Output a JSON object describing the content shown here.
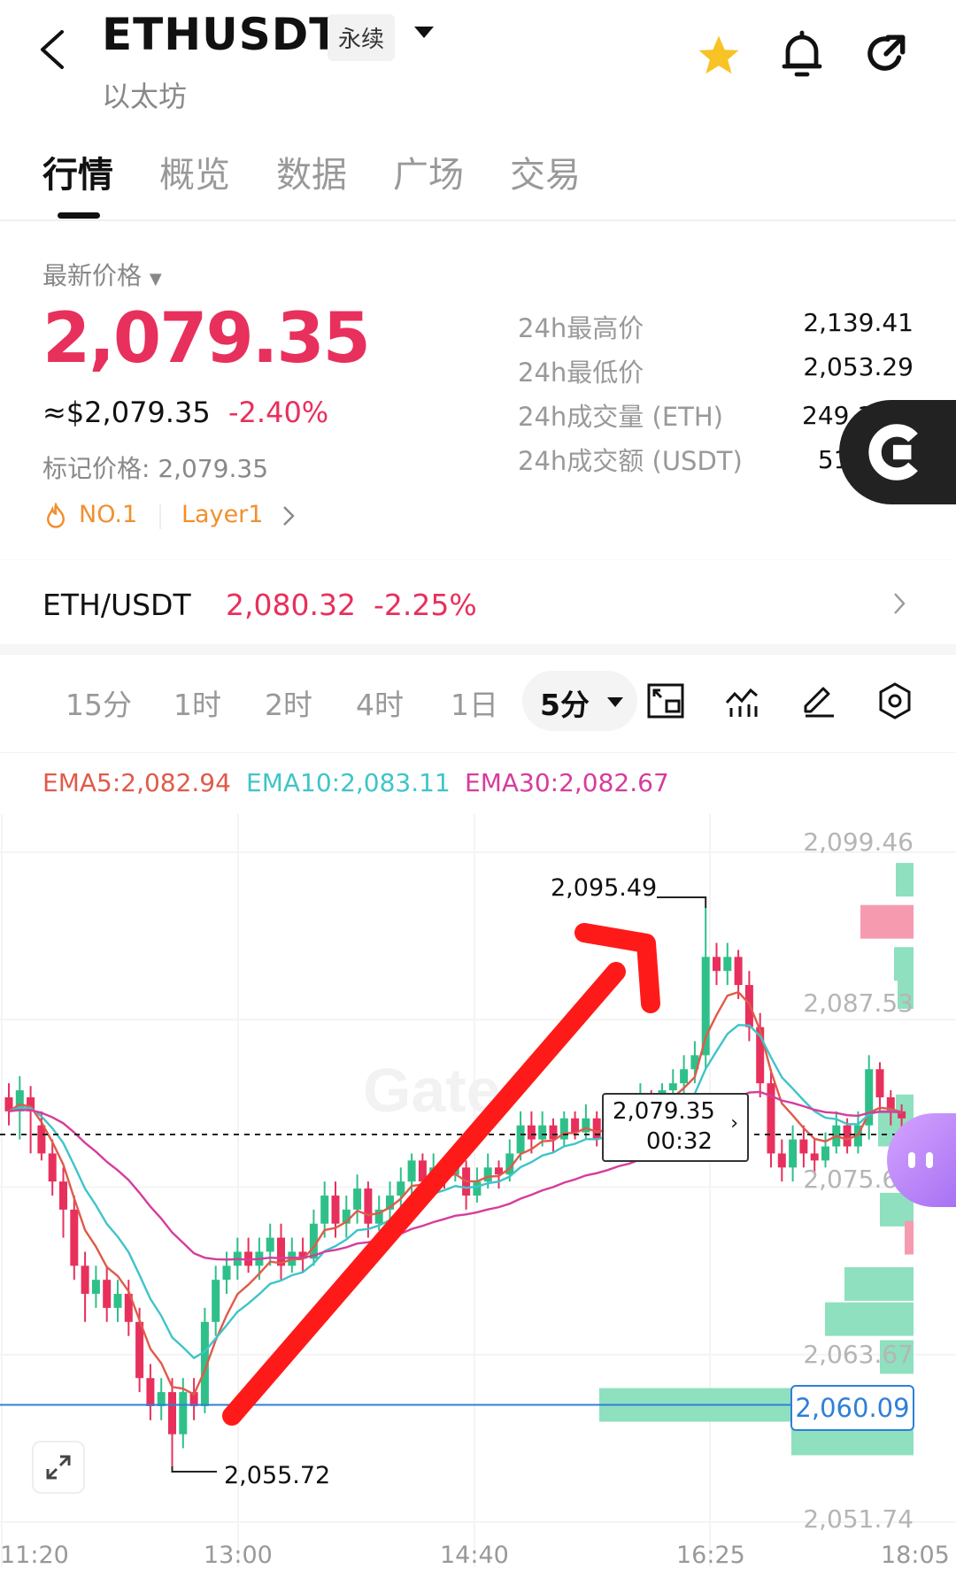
{
  "header": {
    "title": "ETHUSDT",
    "badge": "永续",
    "subtitle": "以太坊"
  },
  "tabs": [
    "行情",
    "概览",
    "数据",
    "广场",
    "交易"
  ],
  "price": {
    "label": "最新价格",
    "last": "2,079.35",
    "usd": "≈$2,079.35",
    "change": "-2.40%",
    "mark": "标记价格: 2,079.35"
  },
  "tags": {
    "rank": "NO.1",
    "sector": "Layer1"
  },
  "stats": [
    {
      "label": "24h最高价",
      "value": "2,139.41"
    },
    {
      "label": "24h最低价",
      "value": "2,053.29"
    },
    {
      "label": "24h成交量 (ETH)",
      "value": "249.14万"
    },
    {
      "label": "24h成交额 (USDT)",
      "value": "51.80亿"
    }
  ],
  "spot": {
    "name": "ETH/USDT",
    "price": "2,080.32",
    "change": "-2.25%"
  },
  "intervals": [
    "15分",
    "1时",
    "2时",
    "4时",
    "1日"
  ],
  "active_interval": "5分",
  "ema": {
    "ema5": "EMA5:2,082.94",
    "ema10": "EMA10:2,083.11",
    "ema30": "EMA30:2,082.67"
  },
  "colors": {
    "up": "#2fc08a",
    "down": "#e8305c",
    "ema5": "#e05a4a",
    "ema10": "#3fc4c9",
    "ema30": "#d63c9c",
    "accent_blue": "#2f7fd8",
    "star": "#f7c325"
  },
  "chart_data": {
    "type": "candlestick",
    "y_ticks": [
      "2,099.46",
      "2,087.53",
      "2,075.60",
      "2,063.67",
      "2,051.74"
    ],
    "x_ticks": [
      "11:20",
      "13:00",
      "14:40",
      "16:25",
      "18:05"
    ],
    "ylim": [
      2051.74,
      2099.46
    ],
    "high_label": "2,095.49",
    "low_label": "2,055.72",
    "current": {
      "price": "2,079.35",
      "countdown": "00:32"
    },
    "marker_price": "2,060.09",
    "candles": [
      [
        2082,
        2081,
        2083,
        2080
      ],
      [
        2081,
        2082.5,
        2083.5,
        2079
      ],
      [
        2082,
        2081,
        2082.8,
        2078
      ],
      [
        2080,
        2078,
        2081,
        2077.5
      ],
      [
        2078,
        2076,
        2079,
        2075
      ],
      [
        2076,
        2074,
        2077,
        2072
      ],
      [
        2074,
        2070,
        2075,
        2069
      ],
      [
        2070,
        2068,
        2071,
        2066
      ],
      [
        2068,
        2069,
        2070,
        2067
      ],
      [
        2069,
        2067,
        2070,
        2066
      ],
      [
        2067,
        2068,
        2069,
        2066
      ],
      [
        2068,
        2066,
        2069,
        2065
      ],
      [
        2066,
        2062,
        2067,
        2061
      ],
      [
        2062,
        2060,
        2063,
        2059
      ],
      [
        2060,
        2061,
        2062,
        2059
      ],
      [
        2061,
        2058,
        2062,
        2055.72
      ],
      [
        2058,
        2061,
        2062,
        2057
      ],
      [
        2061,
        2060,
        2062,
        2059
      ],
      [
        2060,
        2066,
        2067,
        2059.5
      ],
      [
        2066,
        2069,
        2070,
        2065
      ],
      [
        2069,
        2070,
        2071,
        2068
      ],
      [
        2070,
        2071,
        2072,
        2069
      ],
      [
        2071,
        2070,
        2072,
        2069.5
      ],
      [
        2070,
        2071,
        2072,
        2069
      ],
      [
        2071,
        2072,
        2073,
        2070
      ],
      [
        2072,
        2070,
        2073,
        2069
      ],
      [
        2070,
        2071,
        2072,
        2069.5
      ],
      [
        2071,
        2070.5,
        2072,
        2069.5
      ],
      [
        2070.5,
        2073,
        2074,
        2070
      ],
      [
        2073,
        2075,
        2076,
        2072
      ],
      [
        2075,
        2073,
        2076,
        2072
      ],
      [
        2073,
        2074,
        2075,
        2072
      ],
      [
        2074,
        2075.5,
        2076.5,
        2073
      ],
      [
        2075.5,
        2073,
        2076,
        2072
      ],
      [
        2073,
        2074,
        2075,
        2072.5
      ],
      [
        2074,
        2075,
        2076,
        2073
      ],
      [
        2075,
        2076,
        2077,
        2074
      ],
      [
        2076,
        2077.5,
        2078,
        2075
      ],
      [
        2077.5,
        2076,
        2078,
        2075
      ],
      [
        2076,
        2077,
        2078,
        2075.5
      ],
      [
        2077,
        2076.5,
        2077.5,
        2075.5
      ],
      [
        2076.5,
        2077,
        2078,
        2076
      ],
      [
        2077,
        2075,
        2077.5,
        2074
      ],
      [
        2075,
        2076,
        2077,
        2074.5
      ],
      [
        2076,
        2077,
        2078,
        2075.5
      ],
      [
        2077,
        2076.5,
        2077.5,
        2075.5
      ],
      [
        2076.5,
        2078,
        2079,
        2076
      ],
      [
        2078,
        2080,
        2081,
        2077.5
      ],
      [
        2080,
        2079,
        2081,
        2078
      ],
      [
        2079,
        2080,
        2081,
        2078.5
      ],
      [
        2080,
        2079,
        2080.5,
        2078
      ],
      [
        2079,
        2080.5,
        2081,
        2078.5
      ],
      [
        2080.5,
        2079.5,
        2081,
        2079
      ],
      [
        2079.5,
        2080.5,
        2081.5,
        2079
      ],
      [
        2080.5,
        2079,
        2081,
        2078.5
      ],
      [
        2079,
        2080,
        2081,
        2078.5
      ],
      [
        2080,
        2081,
        2082,
        2079.5
      ],
      [
        2081,
        2080,
        2081.5,
        2079
      ],
      [
        2080,
        2082,
        2083,
        2079.5
      ],
      [
        2082,
        2081.5,
        2082.5,
        2081
      ],
      [
        2081.5,
        2082.5,
        2083,
        2081
      ],
      [
        2082.5,
        2083,
        2084,
        2082
      ],
      [
        2083,
        2084,
        2085,
        2082
      ],
      [
        2084,
        2085,
        2086,
        2083
      ],
      [
        2085,
        2092,
        2095.49,
        2084
      ],
      [
        2092,
        2091,
        2093,
        2090
      ],
      [
        2091,
        2092,
        2093,
        2090
      ],
      [
        2092,
        2090,
        2092.5,
        2089
      ],
      [
        2090,
        2087,
        2091,
        2086
      ],
      [
        2087,
        2083,
        2088,
        2082
      ],
      [
        2083,
        2078,
        2084,
        2077
      ],
      [
        2078,
        2077,
        2079,
        2076
      ],
      [
        2077,
        2079,
        2080,
        2076
      ],
      [
        2079,
        2078,
        2080,
        2077
      ],
      [
        2078,
        2077.5,
        2079,
        2076.5
      ],
      [
        2077.5,
        2078.5,
        2079.5,
        2077
      ],
      [
        2078.5,
        2080,
        2081,
        2078
      ],
      [
        2080,
        2078.5,
        2080.5,
        2078
      ],
      [
        2078.5,
        2080,
        2081,
        2078
      ],
      [
        2080,
        2084,
        2085,
        2079
      ],
      [
        2084,
        2082,
        2084.5,
        2081
      ],
      [
        2082,
        2081,
        2082.5,
        2080
      ],
      [
        2081,
        2080.5,
        2081.5,
        2079.5
      ]
    ]
  }
}
